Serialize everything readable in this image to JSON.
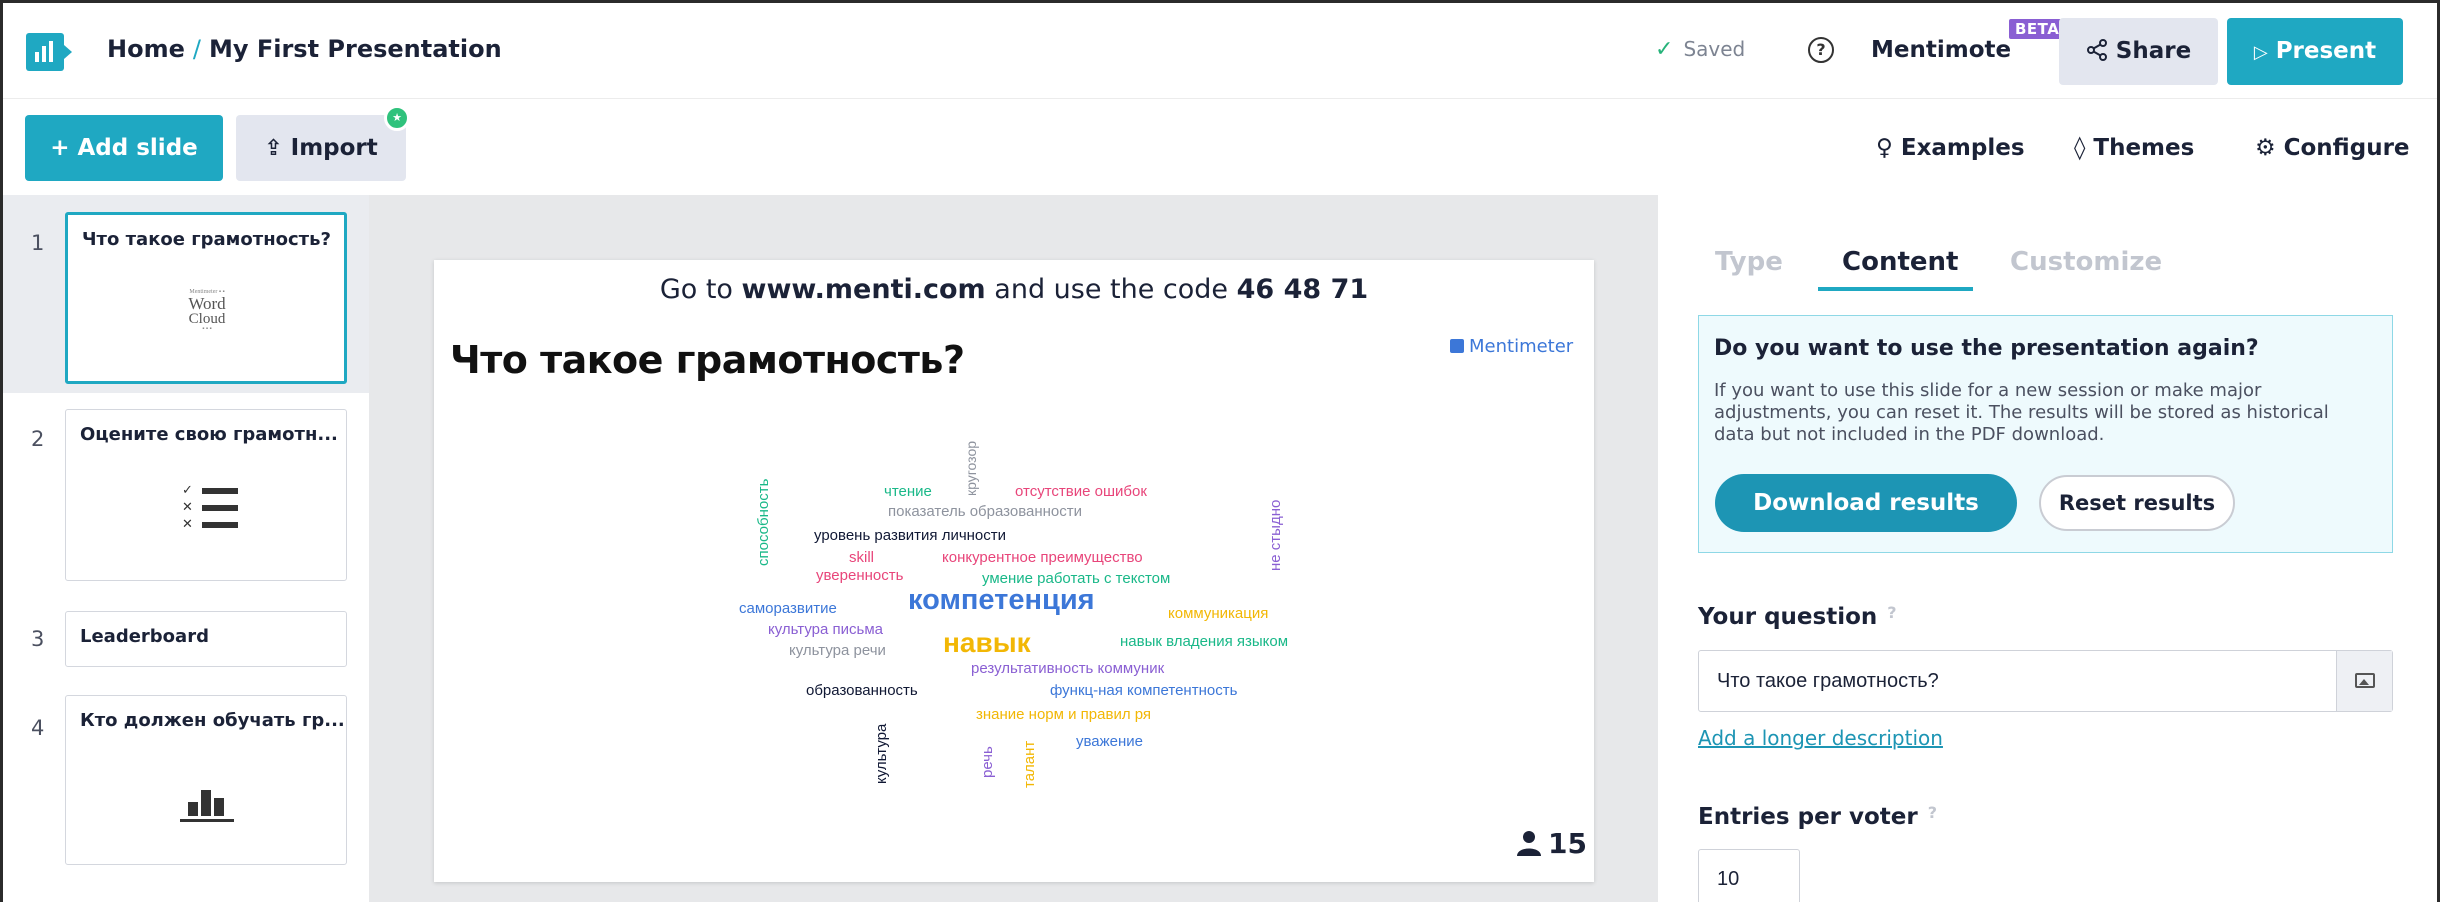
{
  "header": {
    "home": "Home",
    "separator": "/",
    "presentation_title": "My First Presentation",
    "saved_status": "Saved",
    "mentimote": "Mentimote",
    "beta_badge": "BETA",
    "share_label": "Share",
    "present_label": "Present",
    "brand_color": "#1fa8c2"
  },
  "toolbar": {
    "add_slide": "+ Add slide",
    "import": "Import",
    "examples": "Examples",
    "themes": "Themes",
    "configure": "Configure"
  },
  "slides": [
    {
      "num": "1",
      "title": "Что такое грамотность?",
      "type_icon": "word-cloud-icon",
      "preview_words": [
        "Word",
        "Cloud"
      ]
    },
    {
      "num": "2",
      "title": "Оцените свою грамотн...",
      "type_icon": "quiz-list-icon"
    },
    {
      "num": "3",
      "title": "Leaderboard"
    },
    {
      "num": "4",
      "title": "Кто должен обучать гр...",
      "type_icon": "bar-chart-icon"
    }
  ],
  "preview": {
    "code_prefix": "Go to",
    "url": "www.menti.com",
    "code_middle": "and use the code",
    "code": "46 48 71",
    "question": "Что такое грамотность?",
    "brand": "Mentimeter",
    "participants": "15",
    "word_cloud": [
      {
        "text": "кругозор",
        "color": "#8e939e",
        "vertical": true
      },
      {
        "text": "чтение",
        "color": "#19b888"
      },
      {
        "text": "отсутствие ошибок",
        "color": "#e8457a"
      },
      {
        "text": "способность",
        "color": "#19b888",
        "vertical": true
      },
      {
        "text": "показатель образованности",
        "color": "#8e939e"
      },
      {
        "text": "не стыдно",
        "color": "#8a5fd3",
        "vertical": true
      },
      {
        "text": "уровень развития личности",
        "color": "#101834"
      },
      {
        "text": "skill",
        "color": "#e8457a"
      },
      {
        "text": "конкурентное преимущество",
        "color": "#e8457a"
      },
      {
        "text": "уверенность",
        "color": "#e8457a"
      },
      {
        "text": "умение работать с текстом",
        "color": "#19b888"
      },
      {
        "text": "саморазвитие",
        "color": "#3c77d8"
      },
      {
        "text": "компетенция",
        "color": "#3c77d8"
      },
      {
        "text": "коммуникация",
        "color": "#f2b705"
      },
      {
        "text": "культура письма",
        "color": "#8a5fd3"
      },
      {
        "text": "навык",
        "color": "#f2b705"
      },
      {
        "text": "навык владения языком",
        "color": "#19b888"
      },
      {
        "text": "культура речи",
        "color": "#8e939e"
      },
      {
        "text": "результативность коммуник",
        "color": "#8a5fd3"
      },
      {
        "text": "образованность",
        "color": "#101834"
      },
      {
        "text": "функц-ная компетентность",
        "color": "#3c77d8"
      },
      {
        "text": "знание норм и правил ря",
        "color": "#f2b705"
      },
      {
        "text": "культура",
        "color": "#101834",
        "vertical": true
      },
      {
        "text": "речь",
        "color": "#8a5fd3",
        "vertical": true
      },
      {
        "text": "талант",
        "color": "#f2b705",
        "vertical": true
      },
      {
        "text": "уважение",
        "color": "#3c77d8"
      }
    ]
  },
  "panel": {
    "tabs": [
      "Type",
      "Content",
      "Customize"
    ],
    "active_tab": "Content",
    "notice_title": "Do you want to use the presentation again?",
    "notice_body": "If you want to use this slide for a new session or make major adjustments, you can reset it. The results will be stored as historical data but not included in the PDF download.",
    "download_results": "Download results",
    "reset_results": "Reset results",
    "your_question_label": "Your question",
    "question_value": "Что такое грамотность?",
    "add_longer_description": "Add a longer description",
    "entries_label": "Entries per voter",
    "entries_value": "10"
  }
}
